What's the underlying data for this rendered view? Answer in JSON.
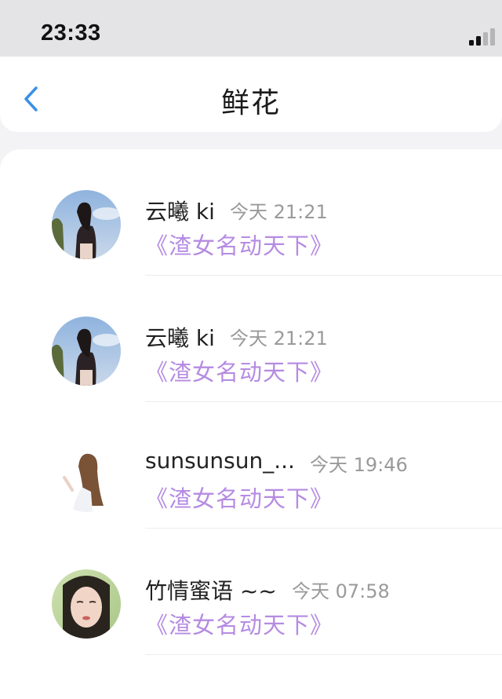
{
  "status_bar": {
    "time": "23:33"
  },
  "nav": {
    "title": "鲜花",
    "back_icon": "chevron-left-icon"
  },
  "list": {
    "items": [
      {
        "name": "云曦 ki",
        "time": "今天 21:21",
        "gift": "《渣女名动天下》"
      },
      {
        "name": "云曦 ki",
        "time": "今天 21:21",
        "gift": "《渣女名动天下》"
      },
      {
        "name": "sunsunsun_...",
        "time": "今天 19:46",
        "gift": "《渣女名动天下》"
      },
      {
        "name": "竹情蜜语 ~~",
        "time": "今天 07:58",
        "gift": "《渣女名动天下》"
      }
    ]
  },
  "colors": {
    "accent_blue": "#3b8fe6",
    "gift_purple": "#b58be2",
    "time_gray": "#9a9a9a"
  }
}
